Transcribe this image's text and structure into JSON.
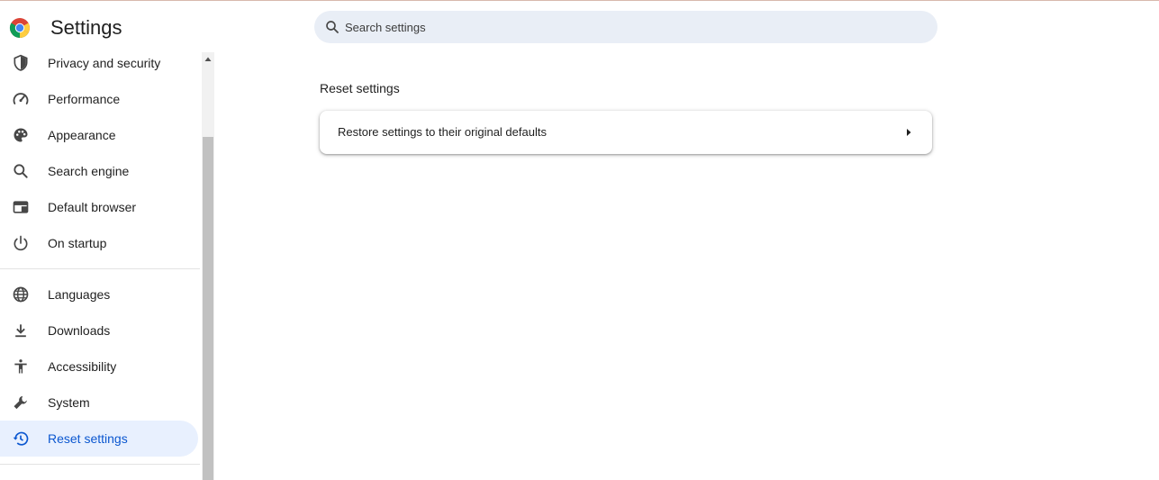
{
  "header": {
    "title": "Settings",
    "logo_icon": "chrome-logo-icon"
  },
  "search": {
    "placeholder": "Search settings",
    "value": "",
    "icon": "search-icon"
  },
  "sidebar": {
    "items": [
      {
        "label": "Privacy and security",
        "icon": "shield-icon"
      },
      {
        "label": "Performance",
        "icon": "speedometer-icon"
      },
      {
        "label": "Appearance",
        "icon": "palette-icon"
      },
      {
        "label": "Search engine",
        "icon": "search-icon"
      },
      {
        "label": "Default browser",
        "icon": "browser-window-icon"
      },
      {
        "label": "On startup",
        "icon": "power-icon"
      },
      {
        "label": "Languages",
        "icon": "globe-icon"
      },
      {
        "label": "Downloads",
        "icon": "download-icon"
      },
      {
        "label": "Accessibility",
        "icon": "accessibility-icon"
      },
      {
        "label": "System",
        "icon": "wrench-icon"
      },
      {
        "label": "Reset settings",
        "icon": "restore-history-icon",
        "active": true
      }
    ]
  },
  "main": {
    "section_title": "Reset settings",
    "card": {
      "label": "Restore settings to their original defaults",
      "icon": "arrow-right-icon"
    }
  },
  "colors": {
    "accent": "#0b57d0",
    "active_bg": "#e8f0fe",
    "search_bg": "#e9eef6",
    "text": "#1f1f1f"
  }
}
